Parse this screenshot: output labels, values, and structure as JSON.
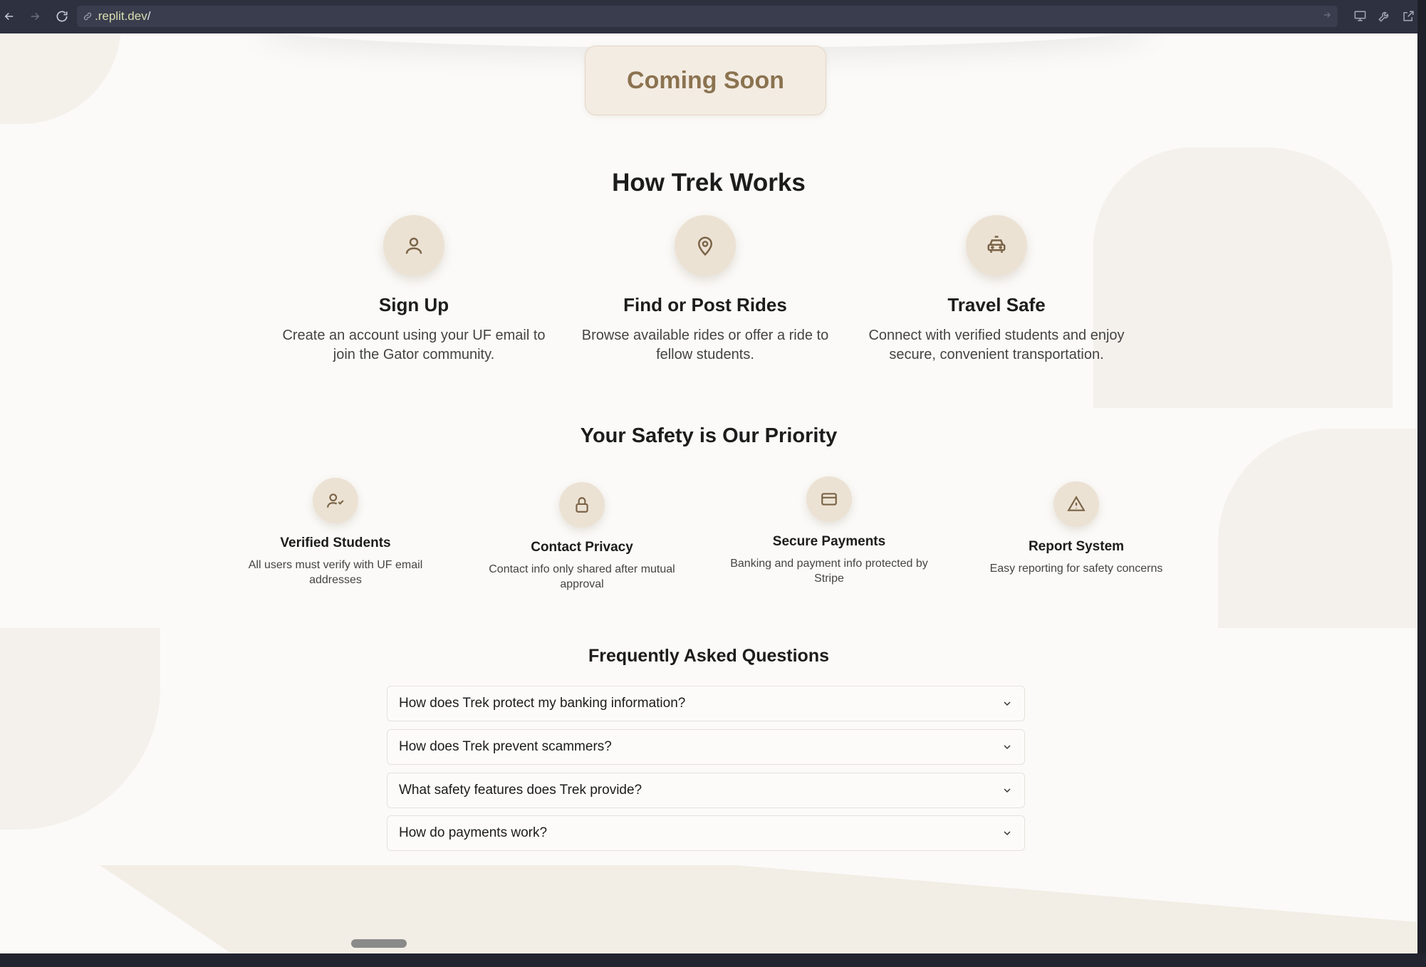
{
  "browser": {
    "url_host": ".replit.dev",
    "url_path": "/"
  },
  "hero": {
    "coming_soon": "Coming Soon"
  },
  "how_it_works": {
    "title": "How Trek Works",
    "steps": [
      {
        "icon": "user-icon",
        "title": "Sign Up",
        "desc": "Create an account using your UF email to join the Gator community."
      },
      {
        "icon": "map-pin-icon",
        "title": "Find or Post Rides",
        "desc": "Browse available rides or offer a ride to fellow students."
      },
      {
        "icon": "car-icon",
        "title": "Travel Safe",
        "desc": "Connect with verified students and enjoy secure, convenient transportation."
      }
    ]
  },
  "safety": {
    "title": "Your Safety is Our Priority",
    "features": [
      {
        "icon": "user-check-icon",
        "title": "Verified Students",
        "desc": "All users must verify with UF email addresses"
      },
      {
        "icon": "lock-icon",
        "title": "Contact Privacy",
        "desc": "Contact info only shared after mutual approval"
      },
      {
        "icon": "credit-card-icon",
        "title": "Secure Payments",
        "desc": "Banking and payment info protected by Stripe"
      },
      {
        "icon": "alert-triangle-icon",
        "title": "Report System",
        "desc": "Easy reporting for safety concerns"
      }
    ]
  },
  "faq": {
    "title": "Frequently Asked Questions",
    "items": [
      "How does Trek protect my banking information?",
      "How does Trek prevent scammers?",
      "What safety features does Trek provide?",
      "How do payments work?"
    ]
  },
  "colors": {
    "accent": "#8b7350",
    "icon_bg": "#ece2d4",
    "page_bg": "#fbfaf8"
  }
}
